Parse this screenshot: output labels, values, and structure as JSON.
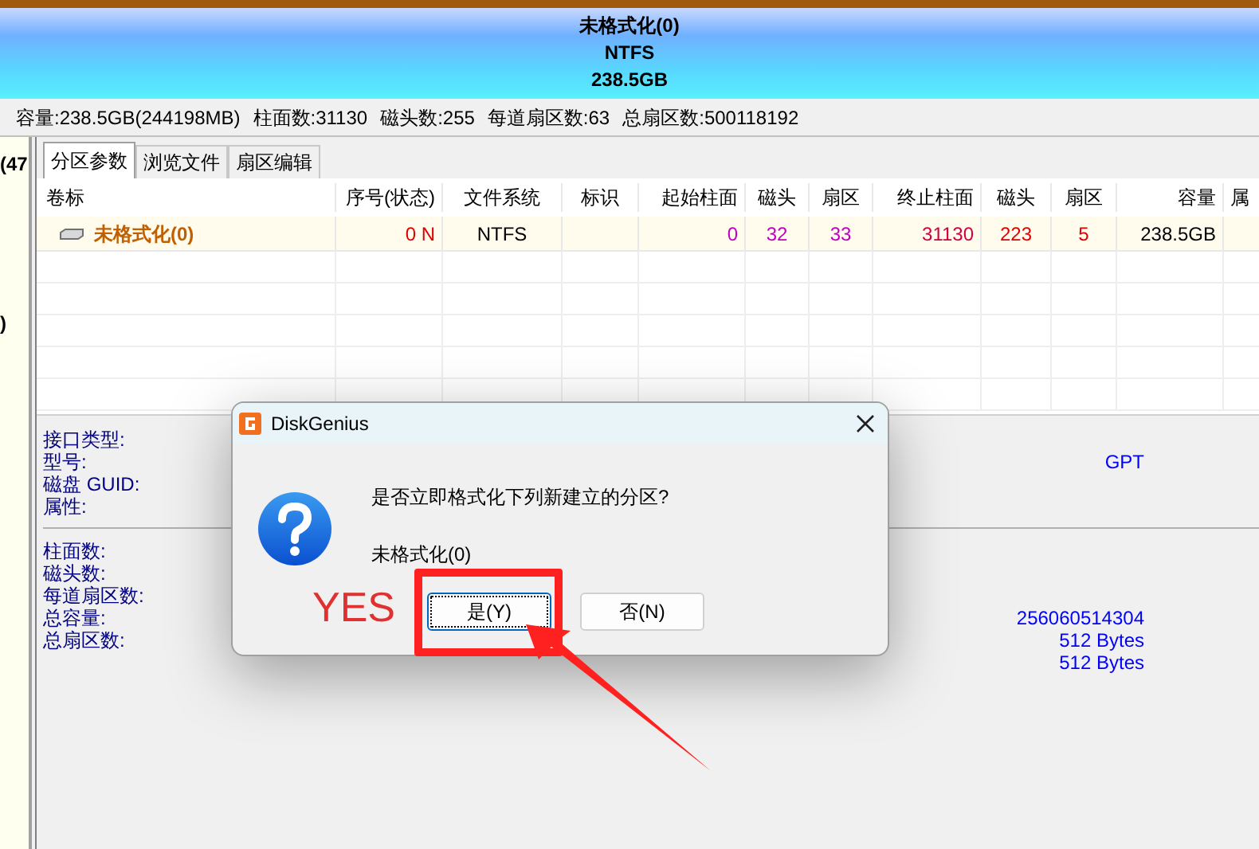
{
  "banner": {
    "lines": [
      "未格式化(0)",
      "NTFS",
      "238.5GB"
    ]
  },
  "disk_info": [
    {
      "label": "容量:238.5GB(244198MB)"
    },
    {
      "label": "柱面数:31130"
    },
    {
      "label": "磁头数:255"
    },
    {
      "label": "每道扇区数:63"
    },
    {
      "label": "总扇区数:500118192"
    }
  ],
  "left_panel": {
    "texts": [
      "(47",
      ")"
    ]
  },
  "tabs": [
    {
      "label": "分区参数",
      "selected": true
    },
    {
      "label": "浏览文件",
      "selected": false
    },
    {
      "label": "扇区编辑",
      "selected": false
    }
  ],
  "table": {
    "columns": [
      "卷标",
      "序号(状态)",
      "文件系统",
      "标识",
      "起始柱面",
      "磁头",
      "扇区",
      "终止柱面",
      "磁头",
      "扇区",
      "容量",
      "属"
    ],
    "rows": [
      {
        "cells": [
          "未格式化(0)",
          "0 N",
          "NTFS",
          "",
          "0",
          "32",
          "33",
          "31130",
          "223",
          "5",
          "238.5GB",
          ""
        ]
      }
    ]
  },
  "details": {
    "group_1": [
      {
        "label": "接口类型:"
      },
      {
        "label": "型号:",
        "value": "GPT"
      },
      {
        "label": "磁盘 GUID:"
      },
      {
        "label": "属性:"
      }
    ],
    "group_2": [
      {
        "label": "柱面数:"
      },
      {
        "label": "磁头数:"
      },
      {
        "label": "每道扇区数:"
      },
      {
        "label": "总容量:",
        "value": "256060514304"
      },
      {
        "label": "总扇区数:",
        "value": "512 Bytes"
      },
      {
        "value": "512 Bytes"
      }
    ]
  },
  "dialog": {
    "title": "DiskGenius",
    "question": "是否立即格式化下列新建立的分区?",
    "item": "未格式化(0)",
    "buttons": [
      {
        "label": "是(Y)",
        "focused": true
      },
      {
        "label": "否(N)",
        "focused": false
      }
    ]
  },
  "annotation": {
    "text": "YES"
  }
}
